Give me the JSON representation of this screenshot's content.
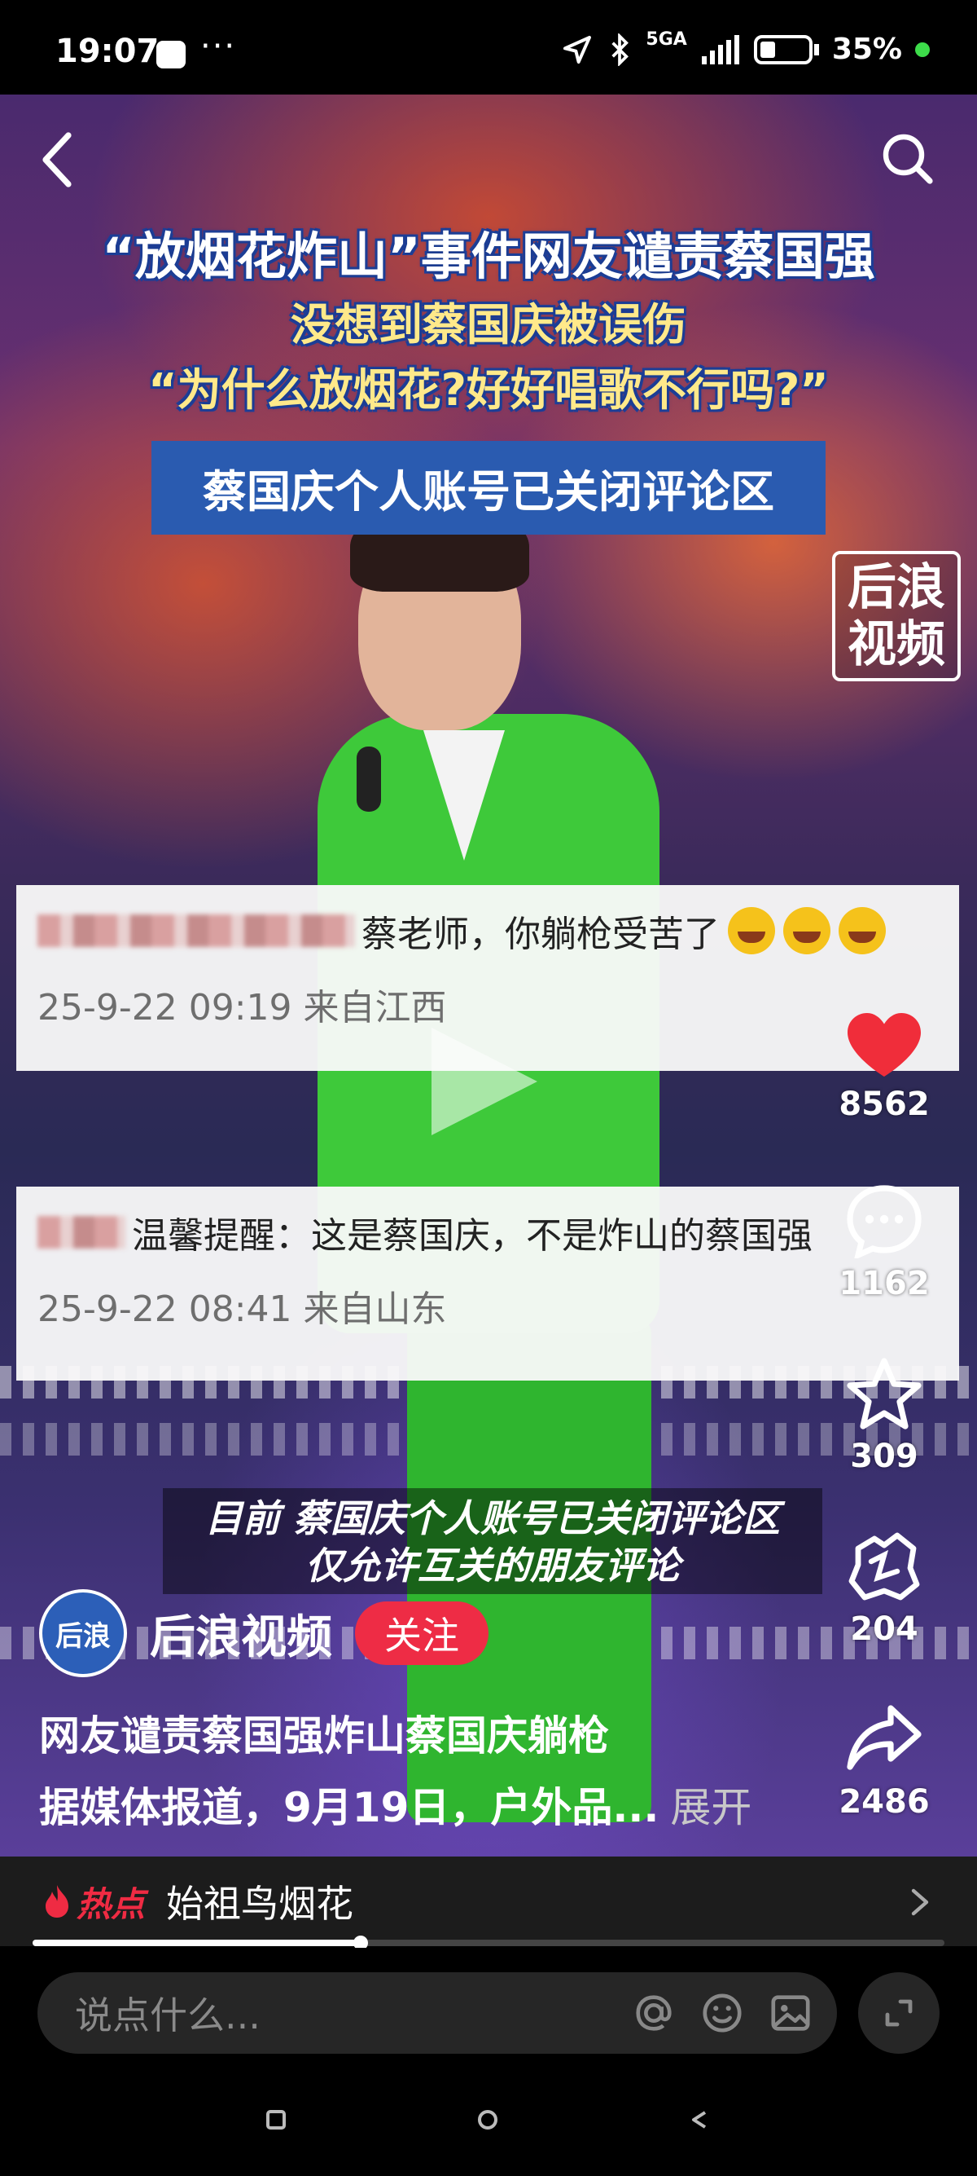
{
  "status_bar": {
    "time": "19:07",
    "dots": "···",
    "network": "5GA",
    "battery": "35%"
  },
  "video": {
    "headline_1": "“放烟花炸山”事件网友谴责蔡国强",
    "headline_2": "没想到蔡国庆被误伤",
    "headline_3": "“为什么放烟花?好好唱歌不行吗?”",
    "banner": "蔡国庆个人账号已关闭评论区",
    "brand_logo": "后浪视频",
    "subtitle_1": "目前 蔡国庆个人账号已关闭评论区",
    "subtitle_2": "仅允许互关的朋友评论",
    "comments": [
      {
        "text": "蔡老师，你躺枪受苦了",
        "meta": "25-9-22 09:19 来自江西"
      },
      {
        "text": "温馨提醒：这是蔡国庆，不是炸山的蔡国强",
        "meta": "25-9-22 08:41 来自山东"
      }
    ]
  },
  "actions": {
    "likes": "8562",
    "comments": "1162",
    "favorites": "309",
    "gifts": "204",
    "shares": "2486",
    "like_color": "#f02d3a"
  },
  "author": {
    "name": "后浪视频",
    "avatar_text": "后浪",
    "follow_label": "关注"
  },
  "post": {
    "title": "网友谴责蔡国强炸山蔡国庆躺枪",
    "description": "据媒体报道，9月19日，户外品...",
    "expand_label": "展开"
  },
  "hot": {
    "label": "热点",
    "topic": "始祖鸟烟花"
  },
  "playback": {
    "progress": 0.36
  },
  "comment_input": {
    "placeholder": "说点什么..."
  },
  "colors": {
    "accent": "#ee2c45",
    "banner": "#2a5bb0"
  }
}
